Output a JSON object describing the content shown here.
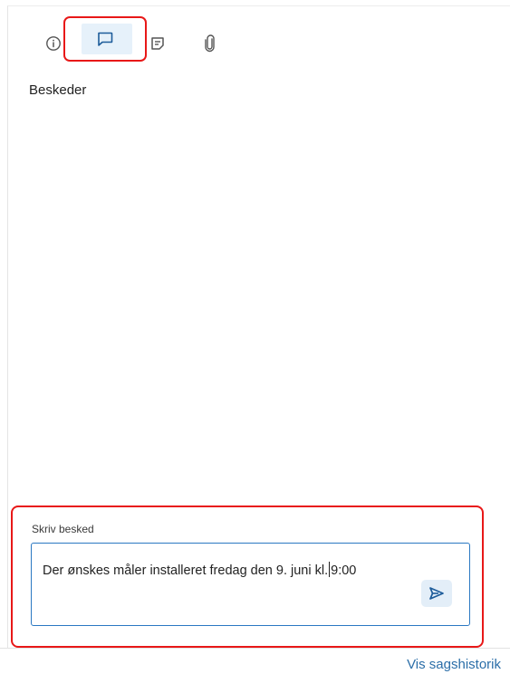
{
  "tabs": [
    {
      "id": "info",
      "icon": "info-icon"
    },
    {
      "id": "messages",
      "icon": "chat-bubble-icon",
      "selected": true
    },
    {
      "id": "notes",
      "icon": "note-icon"
    },
    {
      "id": "attachments",
      "icon": "paperclip-icon"
    }
  ],
  "panel": {
    "title": "Beskeder"
  },
  "composer": {
    "label": "Skriv besked",
    "value_before_caret": "Der ønskes måler installeret fredag den 9. juni kl.",
    "value_after_caret": "9:00",
    "send_icon": "send-icon"
  },
  "footer": {
    "history_link": "Vis sagshistorik"
  },
  "colors": {
    "accent": "#2a78c2",
    "highlight": "#e81818",
    "selected_tab_bg": "#e6f1fa",
    "link": "#2b6ea8"
  }
}
